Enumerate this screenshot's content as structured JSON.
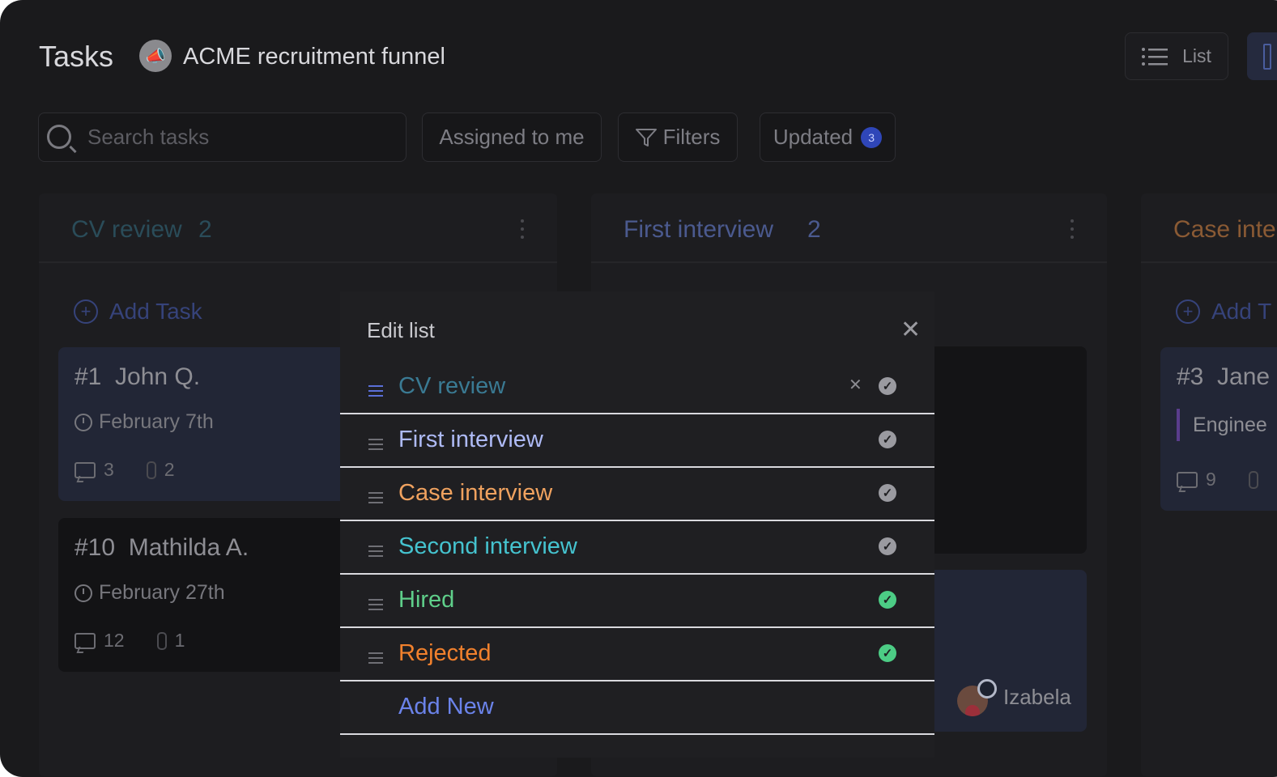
{
  "header": {
    "title": "Tasks",
    "project_icon": "megaphone-icon",
    "project_name": "ACME recruitment funnel",
    "view_list_label": "List"
  },
  "toolbar": {
    "search_placeholder": "Search tasks",
    "assigned_label": "Assigned to me",
    "filters_label": "Filters",
    "updated_label": "Updated",
    "updated_count": "3"
  },
  "columns": [
    {
      "title": "CV review",
      "count": "2",
      "color": "#2a4c59",
      "add_label": "Add Task",
      "cards": [
        {
          "number": "#1",
          "name": "John Q.",
          "date": "February 7th",
          "comments": "3",
          "attachments": "2"
        },
        {
          "number": "#10",
          "name": "Mathilda A.",
          "date": "February 27th",
          "comments": "12",
          "attachments": "1"
        }
      ]
    },
    {
      "title": "First interview",
      "count": "2",
      "color": "#4b5a8f",
      "assignee": "Izabela"
    },
    {
      "title": "Case inte",
      "color": "#8a5a34",
      "add_label": "Add T",
      "cards": [
        {
          "number": "#3",
          "name": "Jane",
          "tag": "Enginee",
          "comments": "9"
        }
      ]
    }
  ],
  "modal": {
    "title": "Edit list",
    "items": [
      {
        "label": "CV review",
        "color": "#3a7a93",
        "check_color": "#9a9aa0"
      },
      {
        "label": "First interview",
        "color": "#aebaf5",
        "check_color": "#9a9aa0"
      },
      {
        "label": "Case interview",
        "color": "#f0a25f",
        "check_color": "#9a9aa0"
      },
      {
        "label": "Second interview",
        "color": "#45c3cf",
        "check_color": "#9a9aa0"
      },
      {
        "label": "Hired",
        "color": "#5fcf8a",
        "check_color": "#4ccc85"
      },
      {
        "label": "Rejected",
        "color": "#f2812d",
        "check_color": "#4ccc85"
      }
    ],
    "add_new_label": "Add New",
    "add_new_color": "#6b83ea"
  }
}
